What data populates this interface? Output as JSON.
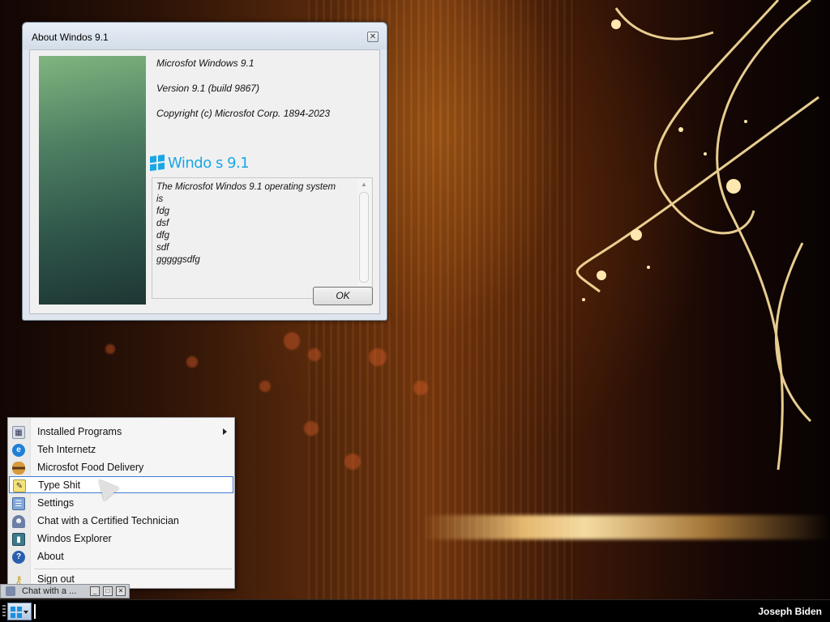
{
  "dialog": {
    "title": "About Windos 9.1",
    "close_glyph": "✕",
    "product_name": "Microsfot Windows 9.1",
    "version": "Version 9.1 (build 9867)",
    "copyright": "Copyright (c) Microsfot Corp. 1894-2023",
    "logo_text": "Windo  s 9.1",
    "description_lines": [
      "The Microsfot Windos 9.1 operating system",
      "is",
      "fdg",
      "dsf",
      "dfg",
      "sdf",
      "gggggsdfg"
    ],
    "ok_label": "OK"
  },
  "start_menu": {
    "items": [
      {
        "label": "Installed Programs",
        "icon": "installed-programs-icon",
        "has_submenu": true
      },
      {
        "label": "Teh Internetz",
        "icon": "internet-explorer-icon"
      },
      {
        "label": "Microsfot Food Delivery",
        "icon": "burger-icon"
      },
      {
        "label": "Type Shit",
        "icon": "notepad-icon",
        "active": true
      },
      {
        "label": "Settings",
        "icon": "settings-icon"
      },
      {
        "label": "Chat with a Certified Technician",
        "icon": "technician-icon"
      },
      {
        "label": "Windos Explorer",
        "icon": "explorer-icon"
      },
      {
        "label": "About",
        "icon": "help-icon"
      },
      {
        "label": "Sign out",
        "icon": "key-icon"
      }
    ]
  },
  "taskbar": {
    "task_button_label": "Chat with a ...",
    "user_name": "Joseph Biden"
  },
  "colors": {
    "accent": "#19a7e6",
    "menu_highlight_border": "#3d7bd6"
  }
}
